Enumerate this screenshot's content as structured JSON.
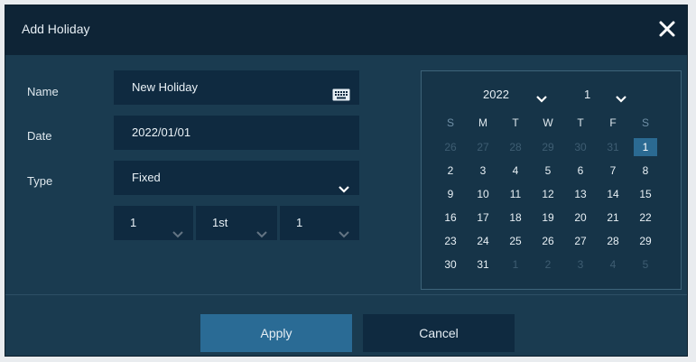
{
  "dialog": {
    "title": "Add Holiday",
    "close_icon": "close-icon"
  },
  "form": {
    "name_label": "Name",
    "name_value": "New Holiday",
    "date_label": "Date",
    "date_value": "2022/01/01",
    "type_label": "Type",
    "type_value": "Fixed",
    "sub_selects": [
      "1",
      "1st",
      "1"
    ]
  },
  "calendar": {
    "year": "2022",
    "month": "1",
    "weekdays": [
      "S",
      "M",
      "T",
      "W",
      "T",
      "F",
      "S"
    ],
    "weeks": [
      [
        "26",
        "27",
        "28",
        "29",
        "30",
        "31",
        "1"
      ],
      [
        "2",
        "3",
        "4",
        "5",
        "6",
        "7",
        "8"
      ],
      [
        "9",
        "10",
        "11",
        "12",
        "13",
        "14",
        "15"
      ],
      [
        "16",
        "17",
        "18",
        "19",
        "20",
        "21",
        "22"
      ],
      [
        "23",
        "24",
        "25",
        "26",
        "27",
        "28",
        "29"
      ],
      [
        "30",
        "31",
        "1",
        "2",
        "3",
        "4",
        "5"
      ]
    ],
    "selected_day": "1"
  },
  "footer": {
    "apply_label": "Apply",
    "cancel_label": "Cancel"
  },
  "colors": {
    "dialog_bg": "#1a3b50",
    "titlebar_bg": "#0e2436",
    "field_bg": "#0f2a40",
    "accent": "#2a6b95"
  }
}
